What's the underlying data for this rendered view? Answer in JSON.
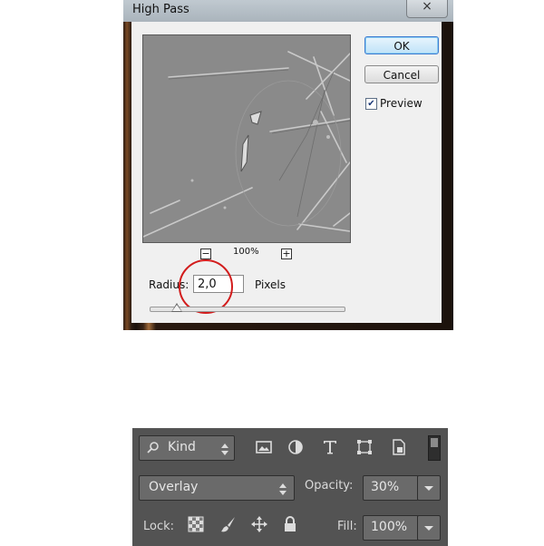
{
  "dialog": {
    "title": "High Pass",
    "close_glyph": "×",
    "ok_label": "OK",
    "cancel_label": "Cancel",
    "preview_label": "Preview",
    "preview_checked": true,
    "zoom_out_glyph": "−",
    "zoom_in_glyph": "+",
    "zoom_level": "100%",
    "radius_label": "Radius:",
    "radius_value": "2,0",
    "unit_label": "Pixels",
    "highlight_color": "#d21c1c"
  },
  "layers_panel": {
    "filter_kind": "Kind",
    "filter_icons": [
      "image-filter-icon",
      "adjustment-filter-icon",
      "type-filter-icon",
      "shape-filter-icon",
      "smart-object-filter-icon"
    ],
    "blend_mode": "Overlay",
    "opacity_label": "Opacity:",
    "opacity_value": "30%",
    "lock_label": "Lock:",
    "lock_icons": [
      "lock-transparent-pixels-icon",
      "lock-image-pixels-icon",
      "lock-position-icon",
      "lock-all-icon"
    ],
    "fill_label": "Fill:",
    "fill_value": "100%"
  }
}
